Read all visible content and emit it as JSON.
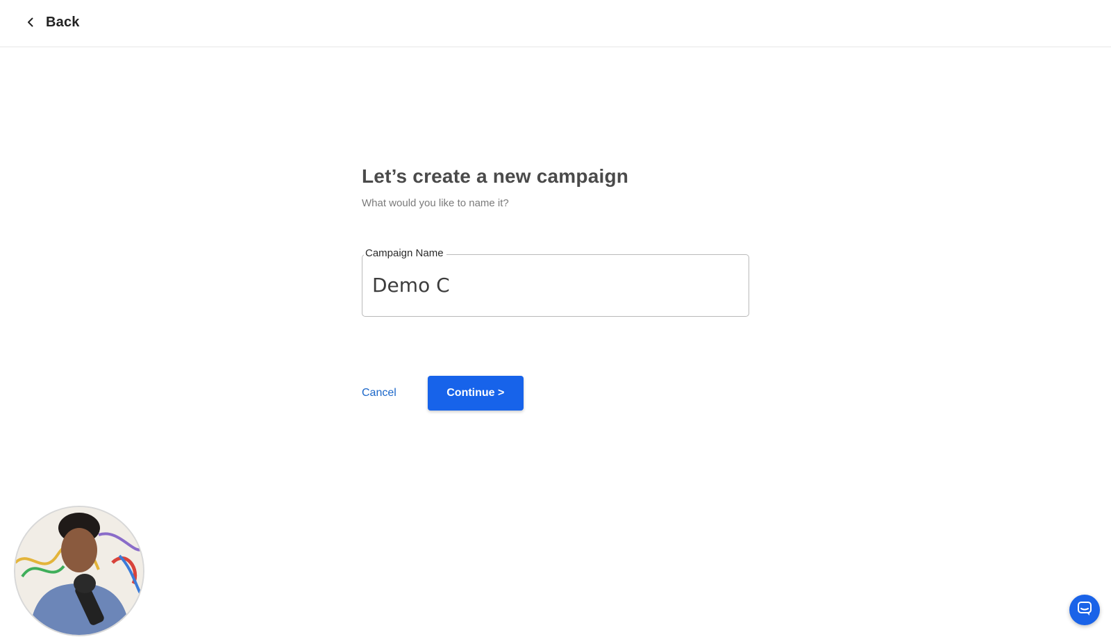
{
  "header": {
    "back_label": "Back",
    "back_icon": "chevron-left-icon"
  },
  "main": {
    "title": "Let’s create a new campaign",
    "subtitle": "What would you like to name it?",
    "campaign_name_field": {
      "label": "Campaign Name",
      "value": "Demo C"
    },
    "cancel_label": "Cancel",
    "continue_label": "Continue >"
  },
  "overlays": {
    "webcam_icon": "presenter-webcam",
    "chat_icon": "chat-bubble-icon"
  },
  "colors": {
    "primary": "#1763ea",
    "link": "#1a66c9",
    "heading": "#4a4a4a",
    "muted": "#7a7a7a"
  }
}
